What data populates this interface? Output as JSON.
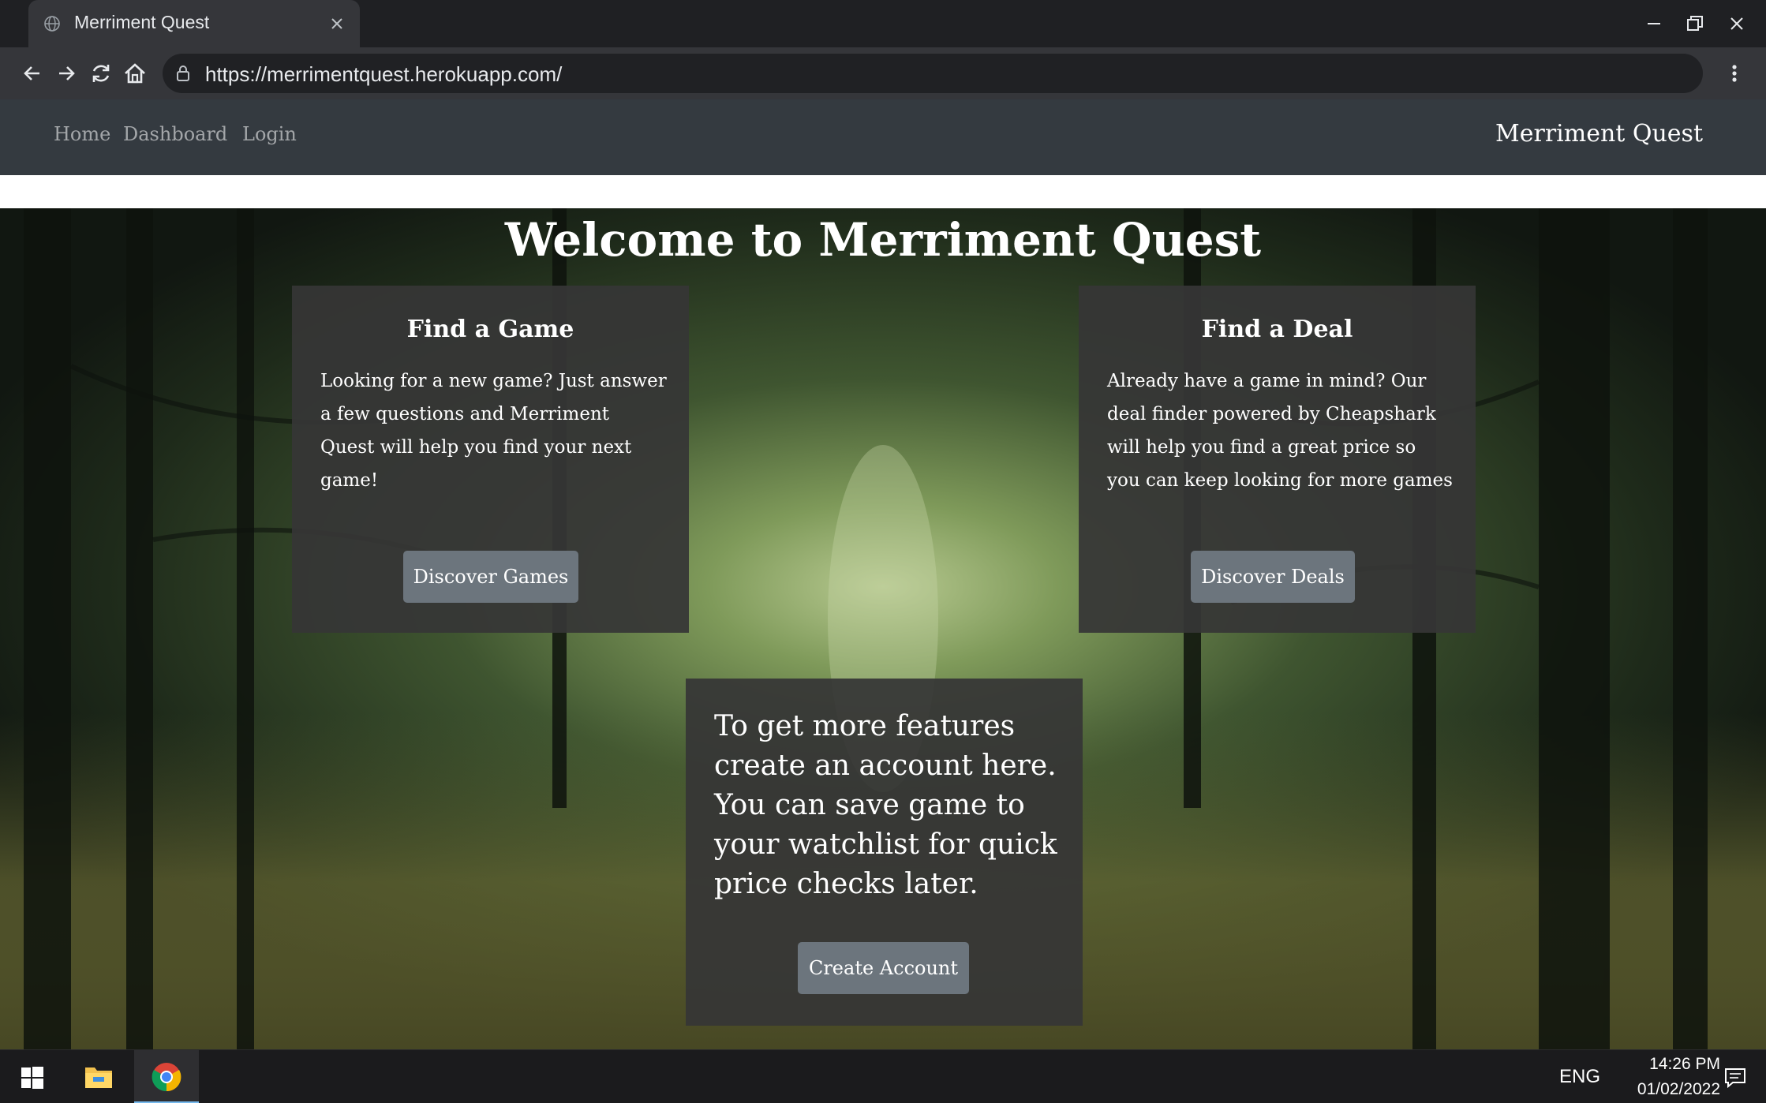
{
  "browser": {
    "tab_title": "Merriment Quest",
    "url": "https://merrimentquest.herokuapp.com/"
  },
  "site_nav": {
    "links": [
      "Home",
      "Dashboard",
      "Login"
    ],
    "brand": "Merriment Quest"
  },
  "hero": {
    "title": "Welcome to Merriment Quest"
  },
  "cards": {
    "game": {
      "title": "Find a Game",
      "text": "Looking for a new game? Just answer a few questions and Merriment Quest will help you find your next game!",
      "button": "Discover Games"
    },
    "deal": {
      "title": "Find a Deal",
      "text": "Already have a game in mind? Our deal finder powered by Cheapshark will help you find a great price so you can keep looking for more games",
      "button": "Discover Deals"
    },
    "account": {
      "text": "To get more features create an account here. You can save game to your watchlist for quick price checks later.",
      "button": "Create Account"
    }
  },
  "taskbar": {
    "language": "ENG",
    "time": "14:26 PM",
    "date": "01/02/2022"
  },
  "icons": {
    "tab": "globe-icon",
    "browser_nav": [
      "back-arrow-icon",
      "forward-arrow-icon",
      "reload-icon",
      "home-icon"
    ],
    "window": [
      "minimize-icon",
      "restore-icon",
      "close-icon"
    ],
    "taskbar": [
      "windows-start-icon",
      "file-explorer-icon",
      "chrome-icon",
      "notifications-icon"
    ]
  },
  "colors": {
    "navbar": "#343a40",
    "card": "#363636",
    "button": "#6c757d",
    "accent_taskbar": "#76b9ed"
  }
}
